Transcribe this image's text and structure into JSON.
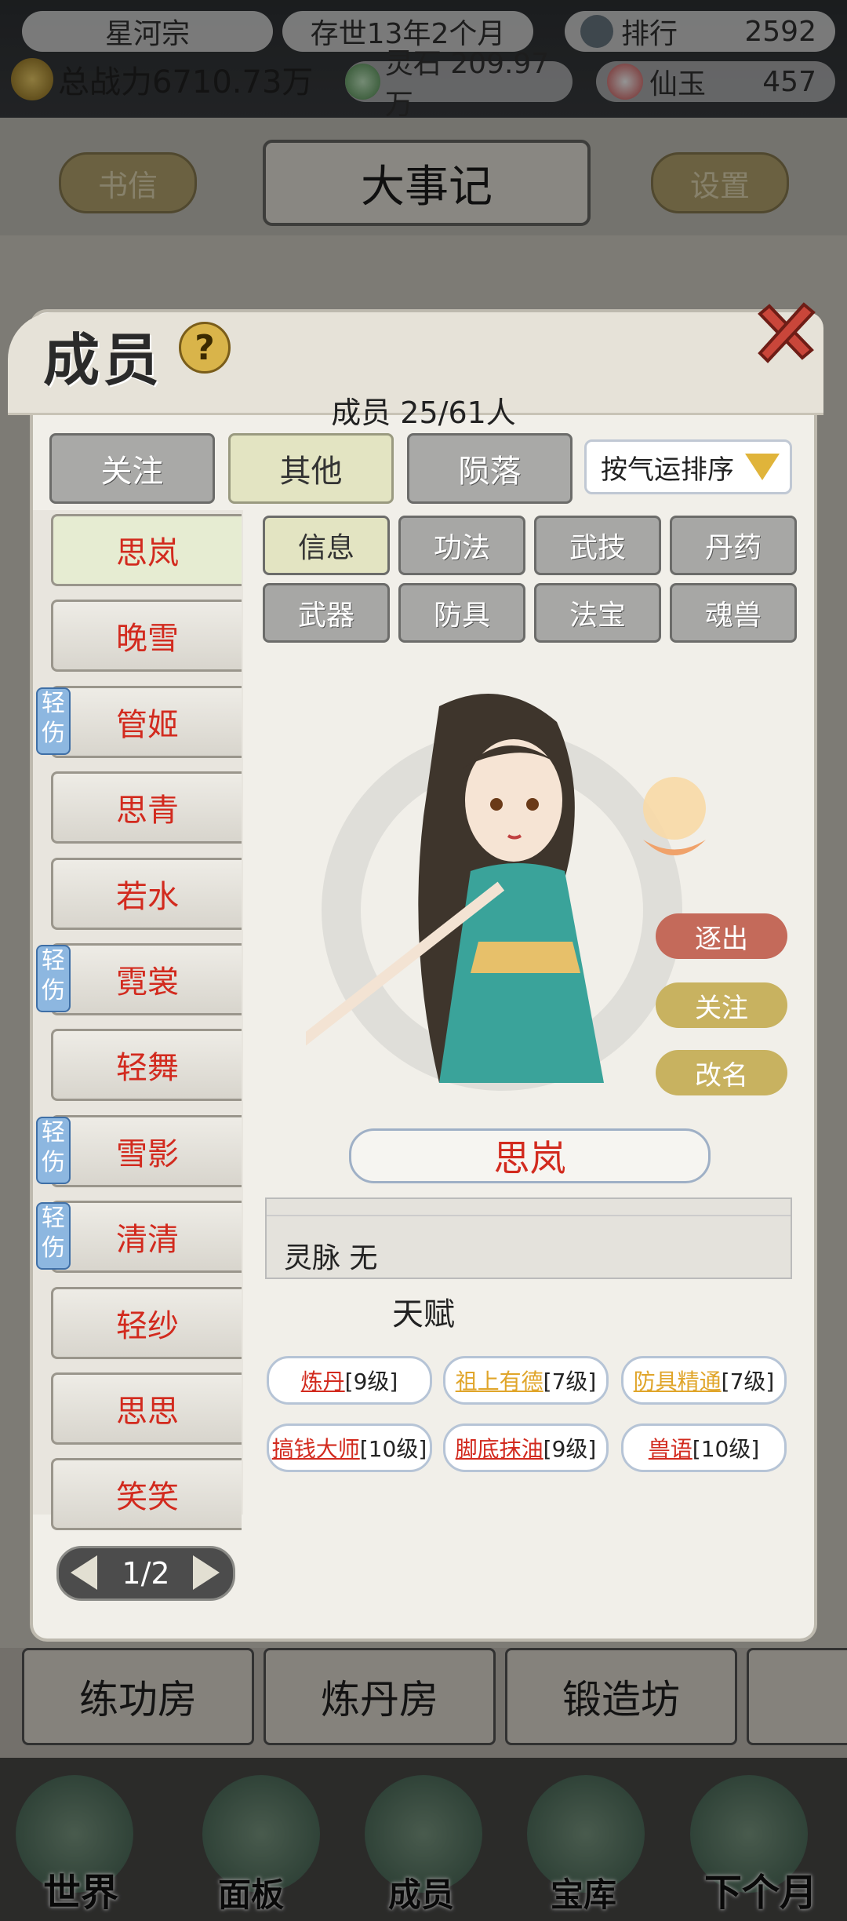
{
  "topbar": {
    "sect_name": "星河宗",
    "duration": "存世13年2个月",
    "rank_label": "排行",
    "rank_value": "2592",
    "power_label": "总战力6710.73万",
    "spirit_stone": "灵石 209.97万",
    "immortal_jade_label": "仙玉",
    "immortal_jade_value": "457"
  },
  "header": {
    "letters_button": "书信",
    "title": "大事记",
    "settings_button": "设置"
  },
  "panel": {
    "title": "成员",
    "help_glyph": "?",
    "member_count": "成员 25/61人",
    "tabs": [
      {
        "label": "关注",
        "active": false
      },
      {
        "label": "其他",
        "active": true
      },
      {
        "label": "陨落",
        "active": false
      }
    ],
    "sort_label": "按气运排序",
    "members": [
      {
        "name": "思岚",
        "injury": "",
        "selected": true
      },
      {
        "name": "晚雪",
        "injury": "",
        "selected": false
      },
      {
        "name": "管姬",
        "injury": "轻伤",
        "selected": false
      },
      {
        "name": "思青",
        "injury": "",
        "selected": false
      },
      {
        "name": "若水",
        "injury": "",
        "selected": false
      },
      {
        "name": "霓裳",
        "injury": "轻伤",
        "selected": false
      },
      {
        "name": "轻舞",
        "injury": "",
        "selected": false
      },
      {
        "name": "雪影",
        "injury": "轻伤",
        "selected": false
      },
      {
        "name": "清清",
        "injury": "轻伤",
        "selected": false
      },
      {
        "name": "轻纱",
        "injury": "",
        "selected": false
      },
      {
        "name": "思思",
        "injury": "",
        "selected": false
      },
      {
        "name": "笑笑",
        "injury": "",
        "selected": false
      }
    ],
    "pager": "1/2",
    "sub_tabs": [
      {
        "label": "信息",
        "active": true
      },
      {
        "label": "功法",
        "active": false
      },
      {
        "label": "武技",
        "active": false
      },
      {
        "label": "丹药",
        "active": false
      },
      {
        "label": "武器",
        "active": false
      },
      {
        "label": "防具",
        "active": false
      },
      {
        "label": "法宝",
        "active": false
      },
      {
        "label": "魂兽",
        "active": false
      }
    ],
    "actions": {
      "expel": "逐出",
      "follow": "关注",
      "rename": "改名"
    },
    "selected_name": "思岚",
    "spirit_vein": "灵脉 无",
    "talent_title": "天赋",
    "talents": [
      {
        "name": "炼丹",
        "level": "[9级]",
        "color": "#d22a1e"
      },
      {
        "name": "祖上有德",
        "level": "[7级]",
        "color": "#e0a52a"
      },
      {
        "name": "防具精通",
        "level": "[7级]",
        "color": "#e0a52a"
      },
      {
        "name": "搞钱大师",
        "level": "[10级]",
        "color": "#d22a1e"
      },
      {
        "name": "脚底抹油",
        "level": "[9级]",
        "color": "#d22a1e"
      },
      {
        "name": "兽语",
        "level": "[10级]",
        "color": "#d22a1e"
      }
    ]
  },
  "rooms": [
    "练功房",
    "炼丹房",
    "锻造坊"
  ],
  "nav": [
    "世界",
    "面板",
    "成员",
    "宝库",
    "下个月"
  ]
}
